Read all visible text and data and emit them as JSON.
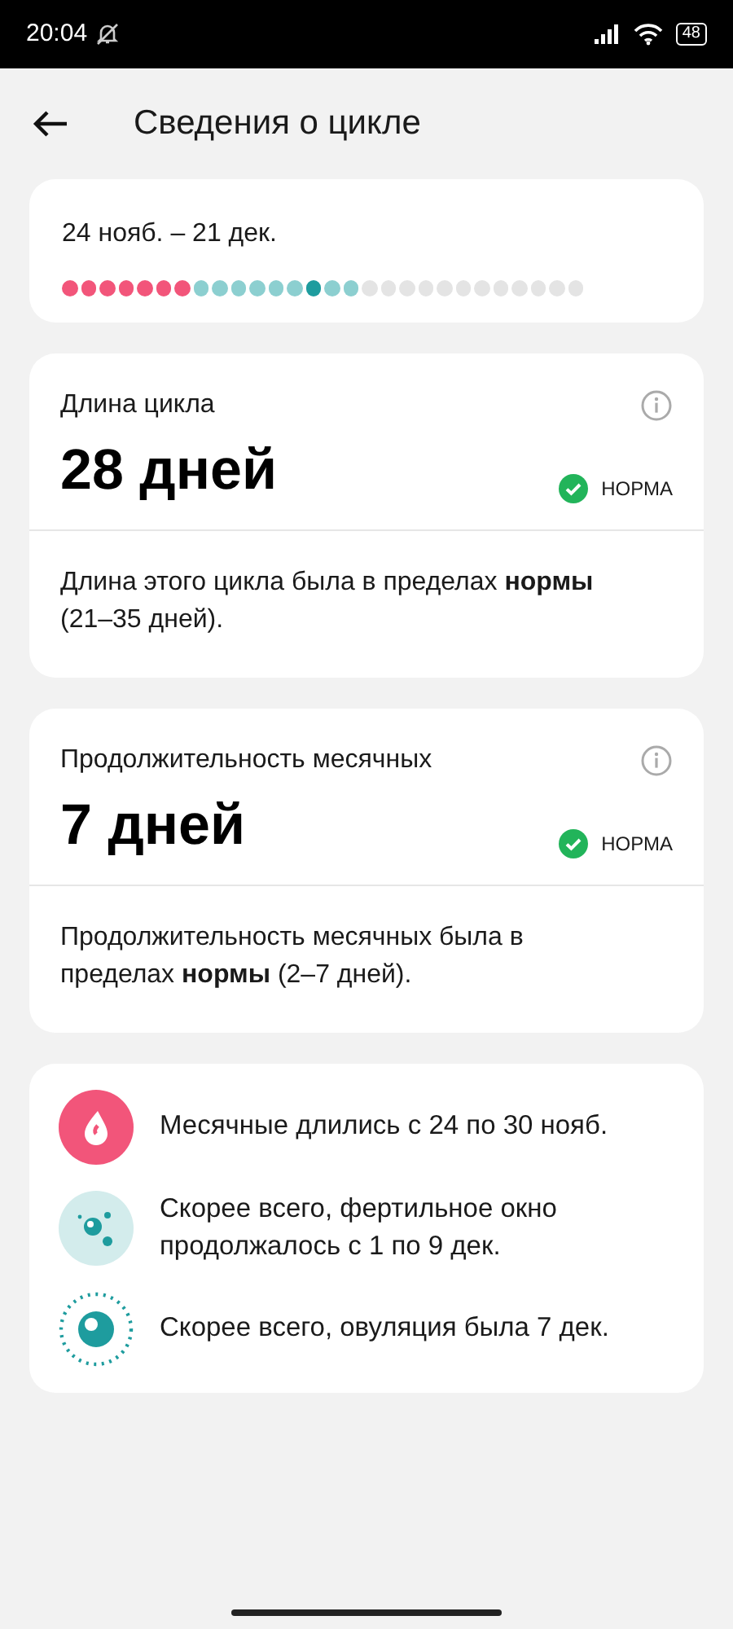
{
  "status_bar": {
    "time": "20:04",
    "battery": "48"
  },
  "header": {
    "title": "Сведения о цикле"
  },
  "cycle": {
    "range": "24 нояб. – 21 дек.",
    "dots": [
      {
        "kind": "period"
      },
      {
        "kind": "period"
      },
      {
        "kind": "period"
      },
      {
        "kind": "period"
      },
      {
        "kind": "period"
      },
      {
        "kind": "period"
      },
      {
        "kind": "period"
      },
      {
        "kind": "fertile"
      },
      {
        "kind": "fertile"
      },
      {
        "kind": "fertile"
      },
      {
        "kind": "fertile"
      },
      {
        "kind": "fertile"
      },
      {
        "kind": "fertile"
      },
      {
        "kind": "ovulation"
      },
      {
        "kind": "fertile"
      },
      {
        "kind": "fertile"
      },
      {
        "kind": "other"
      },
      {
        "kind": "other"
      },
      {
        "kind": "other"
      },
      {
        "kind": "other"
      },
      {
        "kind": "other"
      },
      {
        "kind": "other"
      },
      {
        "kind": "other"
      },
      {
        "kind": "other"
      },
      {
        "kind": "other"
      },
      {
        "kind": "other"
      },
      {
        "kind": "other"
      },
      {
        "kind": "other"
      }
    ]
  },
  "stats": [
    {
      "title": "Длина цикла",
      "value": "28 дней",
      "badge": "НОРМА",
      "description": "Длина этого цикла была в пределах **нормы** (21–35 дней)."
    },
    {
      "title": "Продолжительность месячных",
      "value": "7 дней",
      "badge": "НОРМА",
      "description": "Продолжительность месячных была в пределах **нормы** (2–7 дней)."
    }
  ],
  "summary": [
    {
      "kind": "period",
      "text": "Месячные длились с 24 по 30 нояб."
    },
    {
      "kind": "fertile",
      "text": "Скорее всего, фертильное окно продолжалось с 1 по 9 дек."
    },
    {
      "kind": "ovulation",
      "text": "Скорее всего, овуляция была 7 дек."
    }
  ]
}
